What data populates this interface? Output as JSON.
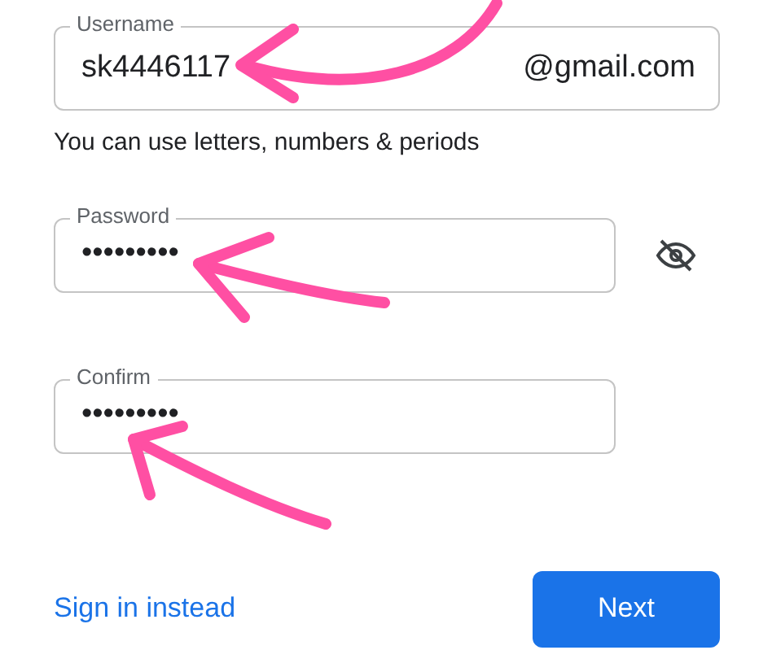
{
  "username": {
    "label": "Username",
    "value": "sk4446117",
    "suffix": "@gmail.com",
    "helper": "You can use letters, numbers & periods"
  },
  "password": {
    "label": "Password",
    "value": "•••••••••",
    "visible": false
  },
  "confirm": {
    "label": "Confirm",
    "value": "•••••••••"
  },
  "link": "Sign in instead",
  "button": "Next"
}
